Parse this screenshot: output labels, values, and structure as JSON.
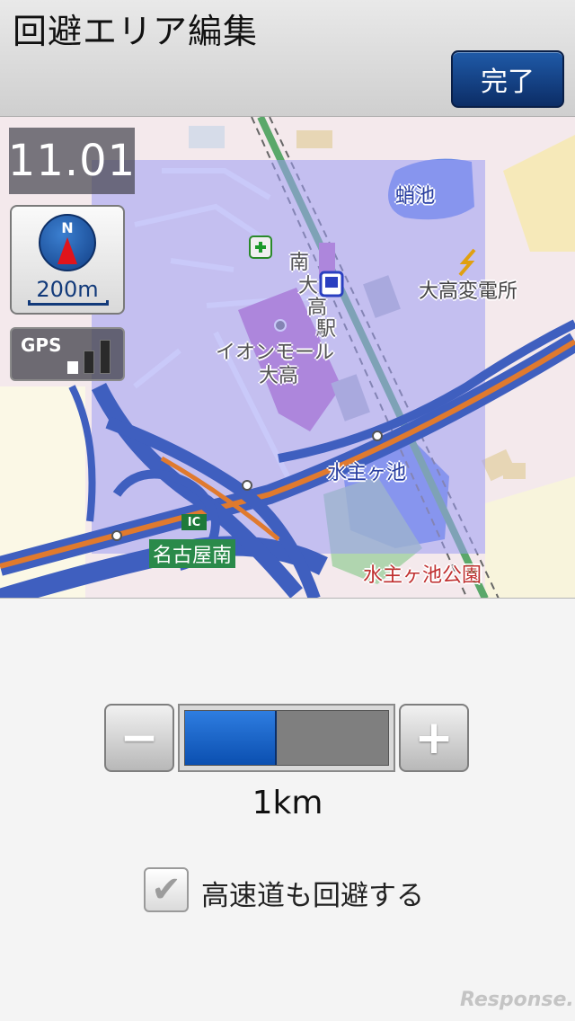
{
  "header": {
    "title": "回避エリア編集",
    "done_label": "完了"
  },
  "map": {
    "time": "11.01",
    "scale_label": "200m",
    "compass_label": "N",
    "gps_label": "GPS",
    "gps_signal_bars": 2,
    "labels": {
      "pond": "蛸池",
      "substation": "大高変電所",
      "station_v1": "南",
      "station_v2": "大",
      "station_v3": "高",
      "station_v4": "駅",
      "mall_line1": "イオンモール",
      "mall_line2": "大高",
      "water_pond": "水主ヶ池",
      "ic_badge": "IC",
      "interchange": "名古屋南",
      "park": "水主ヶ池公園"
    },
    "colors": {
      "avoid_area": "#9c9cf4",
      "expressway": "#3f5fbf",
      "route_orange": "#e07a2e",
      "rail": "#5aa86a"
    }
  },
  "controls": {
    "minus_label": "−",
    "plus_label": "+",
    "slider_level": 0.45,
    "distance_label": "1km",
    "checkbox_checked": true,
    "checkbox_label": "高速道も回避する"
  },
  "watermark": "Response."
}
